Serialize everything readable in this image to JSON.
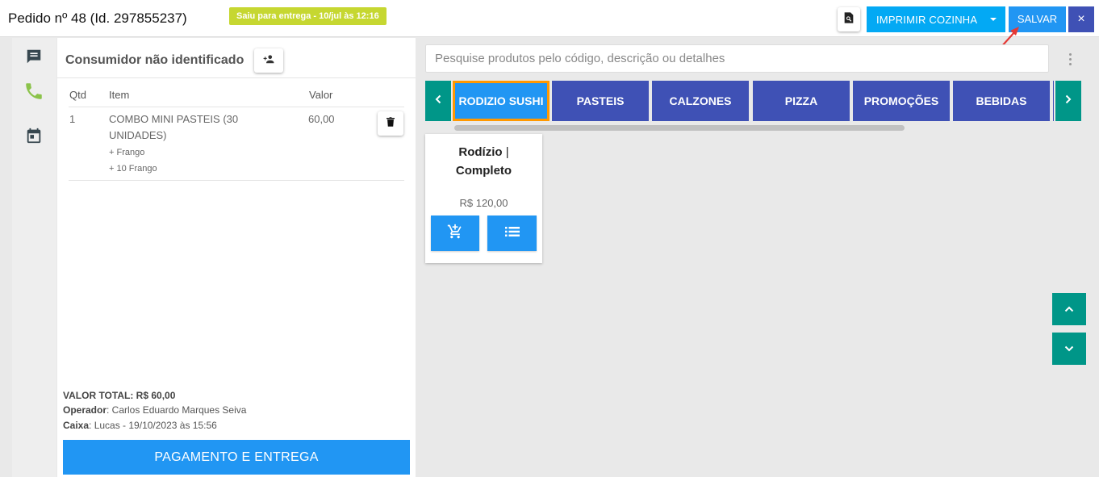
{
  "header": {
    "order_title": "Pedido nº 48 (Id. 297855237)",
    "status_badge": "Saiu para entrega - 10/jul às 12:16",
    "print_label": "IMPRIMIR COZINHA",
    "save_label": "SALVAR",
    "close_label": "×"
  },
  "sidebar": {
    "icons": [
      "chat-icon",
      "phone-icon",
      "calendar-icon"
    ]
  },
  "order": {
    "consumer_title": "Consumidor não identificado",
    "columns": {
      "qty": "Qtd",
      "item": "Item",
      "value": "Valor"
    },
    "items": [
      {
        "qty": "1",
        "name_line1": "COMBO MINI PASTEIS (30",
        "name_line2": "UNIDADES)",
        "value": "60,00",
        "addons": [
          "+ Frango",
          "+ 10 Frango"
        ]
      }
    ],
    "summary": {
      "total_label": "VALOR TOTAL:",
      "total_value": "R$ 60,00",
      "operator_label": "Operador",
      "operator_value": ": Carlos Eduardo Marques Seiva",
      "cashier_label": "Caixa",
      "cashier_value": ": Lucas - 19/10/2023 às 15:56"
    },
    "pay_button": "PAGAMENTO E ENTREGA"
  },
  "products": {
    "search_placeholder": "Pesquise produtos pelo código, descrição ou detalhes",
    "categories": [
      "RODIZIO SUSHI",
      "PASTEIS",
      "CALZONES",
      "PIZZA",
      "PROMOÇÕES",
      "BEBIDAS"
    ],
    "active_category": "RODIZIO SUSHI",
    "card": {
      "name_part1": "Rodízio",
      "name_sep": "|",
      "name_part2": "Completo",
      "price": "R$ 120,00"
    }
  },
  "colors": {
    "primary": "#2196f3",
    "indigo": "#3f51b5",
    "teal": "#009688",
    "badge": "#c6d731",
    "phone_green": "#8bc34a",
    "active_outline": "#ff9800"
  }
}
